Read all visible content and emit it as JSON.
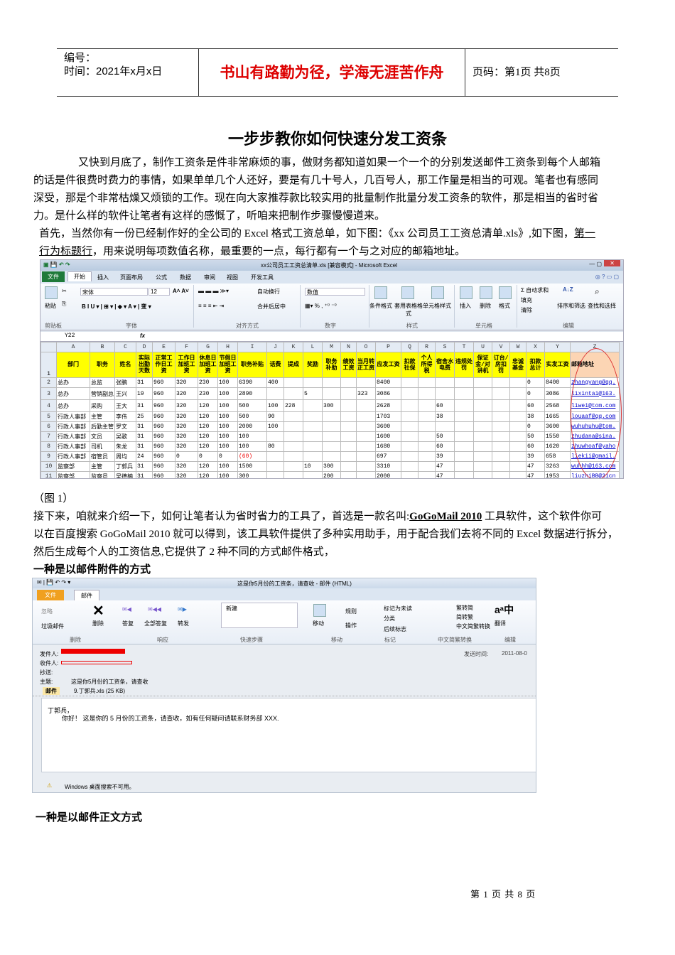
{
  "header": {
    "number_label": "编号：",
    "time_label": "时间：2021年x月x日",
    "motto": "书山有路勤为径，学海无涯苦作舟",
    "page_label": "页码：第1页  共8页"
  },
  "title": "一步步教你如何快速分发工资条",
  "paragraphs": {
    "intro": [
      "又快到月底了，制作工资条是件非常麻烦的事，做财务都知道如果一个一个的分别发送邮件工资条到每个人邮箱",
      "的话是件很费时费力的事情，如果单单几个人还好，要是有几十号人，几百号人，那工作量是相当的可观。笔者也有感同",
      "深受，那是个非常枯燥又烦锁的工作。现在向大家推荐款比较实用的批量制作批量分发工资条的软件，那是相当的省时省",
      "力。是什么样的软件让笔者有这样的感慨了，听咱来把制作步骤慢慢道来。"
    ],
    "first_a": "首先，当然你有一份已经制作好的全公司的 Excel 格式工资总单，如下图：《xx 公司员工工资总清单.xls》,如下图，",
    "first_link1": "第一",
    "first_link2": "行为标题行",
    "first_b": "，用来说明每项数值名称，最重要的一点，每行都有一个与之对应的邮箱地址。",
    "fig_caption": "（图 1）",
    "next_a": "接下来，咱就来介绍一下，如何让笔者认为省时省力的工具了，首选是一款名叫:",
    "next_tool": "GoGoMail 2010",
    "next_b": " 工具软件，这个软件你可",
    "next_2": "以在百度搜索 GoGoMail 2010 就可以得到，该工具软件提供了多种实用助手，用于配合我们去将不同的 Excel 数据进行拆分，",
    "next_3": "然后生成每个人的工资信息,它提供了 2 种不同的方式邮件格式，",
    "heading_attach": "一种是以邮件附件的方式",
    "heading_body": "一种是以邮件正文方式"
  },
  "excel": {
    "window_title": "xx公司员工工资总清单.xls  [兼容模式]  -  Microsoft Excel",
    "tabs": [
      "文件",
      "开始",
      "插入",
      "页面布局",
      "公式",
      "数据",
      "审阅",
      "视图",
      "开发工具"
    ],
    "ribbon": {
      "paste": "粘贴",
      "font_name": "宋体",
      "font_size": "12",
      "wrap": "自动换行",
      "merge": "合并后居中",
      "number_format": "数值",
      "cond_format": "条件格式",
      "table_format": "套用表格格式",
      "cell_style": "单元格样式",
      "insert": "插入",
      "delete": "删除",
      "format": "格式",
      "autosum": "Σ 自动求和",
      "fill": "填充",
      "clear": "清除",
      "sort": "排序和筛选",
      "find": "查找和选择",
      "groups": [
        "剪贴板",
        "字体",
        "对齐方式",
        "数字",
        "样式",
        "单元格",
        "编辑"
      ]
    },
    "name_box": "Y22",
    "fx": "fx",
    "columns": [
      "A",
      "B",
      "C",
      "D",
      "E",
      "F",
      "G",
      "H",
      "I",
      "J",
      "K",
      "L",
      "M",
      "N",
      "O",
      "P",
      "Q",
      "R",
      "S",
      "T",
      "U",
      "V",
      "W",
      "X",
      "Y",
      "Z"
    ],
    "headers": [
      "部门",
      "职务",
      "姓名",
      "实际出勤天数",
      "正常工作日工资",
      "工作日加班工资",
      "休息日加班工资",
      "节假日加班工资",
      "职务补贴",
      "话费",
      "提成",
      "奖励",
      "职务补助",
      "绩效工资",
      "当月转正工资",
      "应发工资",
      "扣款社保",
      "个人所得税",
      "宿舍水电费",
      "违规处罚",
      "保证金/对讲机",
      "订台/房扣罚",
      "忠诚基金",
      "扣款总计",
      "实发工资",
      "邮箱地址"
    ],
    "rows": [
      [
        "总办",
        "总监",
        "张鹏",
        "31",
        "960",
        "320",
        "230",
        "100",
        "6390",
        "400",
        "",
        "",
        "",
        "",
        "",
        "8400",
        "",
        "",
        "",
        "",
        "",
        "",
        "",
        "0",
        "8400",
        "zhangyang@qq."
      ],
      [
        "总办",
        "营销副总",
        "王兴",
        "19",
        "960",
        "320",
        "230",
        "100",
        "2890",
        "",
        "",
        "5",
        "",
        "",
        "323",
        "3086",
        "",
        "",
        "",
        "",
        "",
        "",
        "",
        "0",
        "3086",
        "lixintai@163."
      ],
      [
        "总办",
        "采购",
        "王大",
        "31",
        "960",
        "320",
        "120",
        "100",
        "500",
        "100",
        "228",
        "",
        "300",
        "",
        "",
        "2628",
        "",
        "",
        "60",
        "",
        "",
        "",
        "",
        "60",
        "2568",
        "liwei@tom.com"
      ],
      [
        "行政人事部",
        "主管",
        "李伟",
        "25",
        "960",
        "320",
        "120",
        "100",
        "500",
        "90",
        "",
        "",
        "",
        "",
        "",
        "1703",
        "",
        "",
        "38",
        "",
        "",
        "",
        "",
        "38",
        "1665",
        "louaaf@qq.com"
      ],
      [
        "行政人事部",
        "后勤主管",
        "罗文",
        "31",
        "960",
        "320",
        "120",
        "100",
        "2000",
        "100",
        "",
        "",
        "",
        "",
        "",
        "3600",
        "",
        "",
        "",
        "",
        "",
        "",
        "",
        "0",
        "3600",
        "wuhuhuhu@tom."
      ],
      [
        "行政人事部",
        "文员",
        "吴歌",
        "31",
        "960",
        "320",
        "120",
        "100",
        "100",
        "",
        "",
        "",
        "",
        "",
        "",
        "1600",
        "",
        "",
        "50",
        "",
        "",
        "",
        "",
        "50",
        "1550",
        "zhudana@sina."
      ],
      [
        "行政人事部",
        "司机",
        "朱龙",
        "31",
        "960",
        "320",
        "120",
        "100",
        "100",
        "80",
        "",
        "",
        "",
        "",
        "",
        "1680",
        "",
        "",
        "60",
        "",
        "",
        "",
        "",
        "60",
        "1620",
        "zhuwhoaf@yaho"
      ],
      [
        "行政人事部",
        "宿管员",
        "周均",
        "24",
        "960",
        "0",
        "0",
        "0",
        "(60)",
        "",
        "",
        "",
        "",
        "",
        "",
        "697",
        "",
        "",
        "39",
        "",
        "",
        "",
        "",
        "39",
        "658",
        "liekii@gmail."
      ],
      [
        "监察部",
        "主管",
        "丁郭兵",
        "31",
        "960",
        "320",
        "120",
        "100",
        "1500",
        "",
        "",
        "10",
        "300",
        "",
        "",
        "3310",
        "",
        "",
        "47",
        "",
        "",
        "",
        "",
        "47",
        "3263",
        "wuhhh@163.com"
      ],
      [
        "监察部",
        "监察员",
        "吴德楠",
        "31",
        "960",
        "320",
        "120",
        "100",
        "300",
        "",
        "",
        "",
        "200",
        "",
        "",
        "2000",
        "",
        "",
        "47",
        "",
        "",
        "",
        "",
        "47",
        "1953",
        "liuzhiBB@21cn"
      ]
    ]
  },
  "mail": {
    "window_title": "这是你5月份的工资条，请查收  -  邮件 (HTML)",
    "tabs": [
      "文件",
      "邮件"
    ],
    "ignore": "忽略",
    "junk": "垃圾邮件",
    "delete": "删除",
    "reply": "答复",
    "reply_all": "全部答复",
    "forward": "转发",
    "new": "新建",
    "move": "移动",
    "rules": "规则",
    "actions": "操作",
    "mark_unread": "标记为未读",
    "categorize": "分类",
    "follow_up": "后续标志",
    "t2s": "繁转简",
    "s2t": "简转繁",
    "convert": "中文简繁转换",
    "translate": "翻译",
    "groups": [
      "删除",
      "响应",
      "快速步骤",
      "移动",
      "标记",
      "中文简繁转换",
      "编辑"
    ],
    "from_label": "发件人:",
    "to_label": "收件人:",
    "cc_label": "抄送:",
    "subject_label": "主题:",
    "subject": "这是你5月份的工资条，请查收",
    "sent_label": "发送时间:",
    "sent": "2011-08-0",
    "msg_tab": "邮件",
    "attachment": "9.丁郭兵.xls (25 KB)",
    "greeting": "丁郭兵，",
    "body": "你好！ 这是你的 5 月份的工资条，请查收，如有任何疑问请联系财务部 XXX.",
    "status": "Windows 桌面搜索不可用。"
  },
  "footer": "第 1 页 共 8 页"
}
